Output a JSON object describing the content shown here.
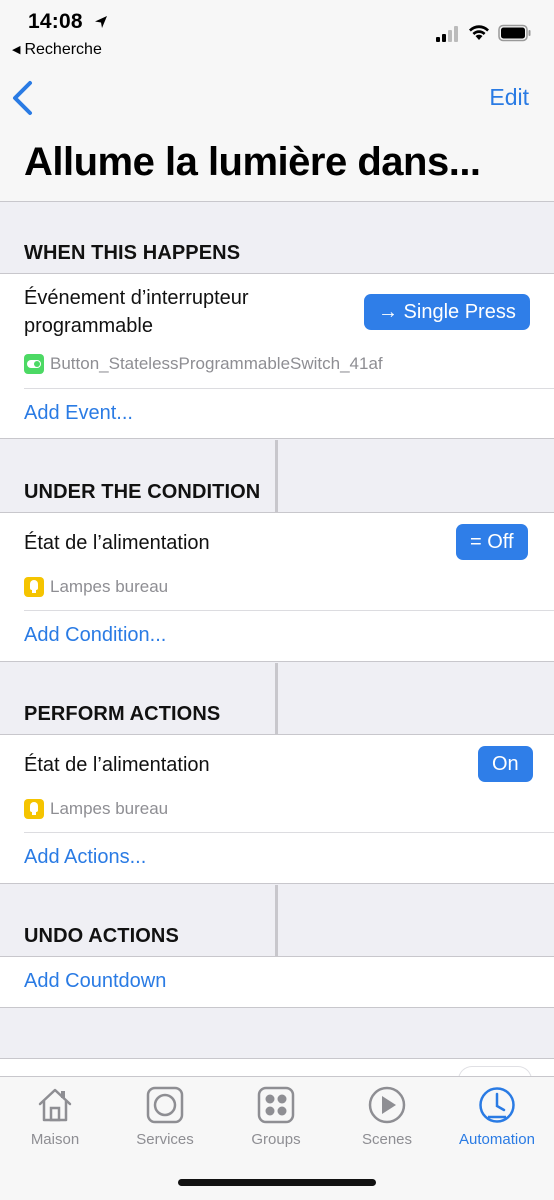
{
  "status_bar": {
    "time": "14:08",
    "back_app": "Recherche"
  },
  "nav": {
    "edit_label": "Edit",
    "title": "Allume la lumière dans..."
  },
  "when": {
    "header": "WHEN THIS HAPPENS",
    "event_title_line1": "Événement d’interrupteur",
    "event_title_line2": "programmable",
    "event_value": "→ Single Press",
    "accessory": "Button_StatelessProgrammableSwitch_41af",
    "add_label": "Add Event..."
  },
  "condition": {
    "header": "UNDER THE CONDITION",
    "title": "État de l’alimentation",
    "value": "= Off",
    "accessory": "Lampes bureau",
    "add_label": "Add Condition..."
  },
  "actions": {
    "header": "PERFORM ACTIONS",
    "title": "État de l’alimentation",
    "value": "On",
    "accessory": "Lampes bureau",
    "add_label": "Add Actions..."
  },
  "undo": {
    "header": "UNDO ACTIONS",
    "add_label": "Add Countdown"
  },
  "tabbar": {
    "items": [
      {
        "label": "Maison",
        "icon": "house-icon"
      },
      {
        "label": "Services",
        "icon": "services-icon"
      },
      {
        "label": "Groups",
        "icon": "groups-icon"
      },
      {
        "label": "Scenes",
        "icon": "scenes-icon"
      },
      {
        "label": "Automation",
        "icon": "clock-icon",
        "active": true
      }
    ]
  },
  "colors": {
    "accent": "#2a7be4",
    "pill": "#2f7ee8",
    "background": "#efeff4",
    "secondary_text": "#8e8e93"
  }
}
